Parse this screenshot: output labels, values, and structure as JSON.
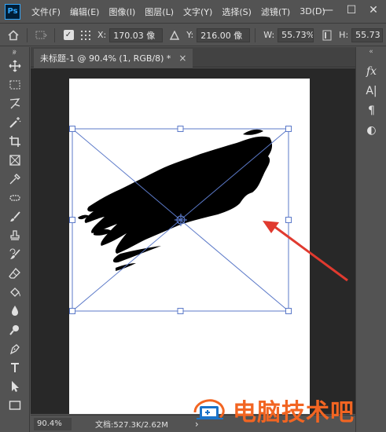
{
  "app": {
    "logo": "Ps"
  },
  "menu": [
    "文件(F)",
    "编辑(E)",
    "图像(I)",
    "图层(L)",
    "文字(Y)",
    "选择(S)",
    "滤镜(T)",
    "3D(D)"
  ],
  "window_controls": {
    "minimize": "—",
    "maximize": "☐",
    "close": "✕"
  },
  "options": {
    "x_label": "X:",
    "x_value": "170.03 像",
    "y_label": "Y:",
    "y_value": "216.00 像",
    "w_label": "W:",
    "w_value": "55.73%",
    "h_label": "H:",
    "h_value": "55.73"
  },
  "document_tab": {
    "title": "未标题-1 @ 90.4% (1, RGB/8) *",
    "close": "×"
  },
  "status": {
    "zoom": "90.4%",
    "doc_size": "文档:527.3K/2.62M",
    "arrow": "›"
  },
  "right_panel": [
    "fx",
    "A|",
    "¶",
    "◐"
  ],
  "watermark": {
    "text": "电脑技术吧"
  },
  "colors": {
    "accent": "#31a8ff",
    "transform": "#5b79c8",
    "arrow": "#e03a2f",
    "watermark": "#f26522"
  }
}
